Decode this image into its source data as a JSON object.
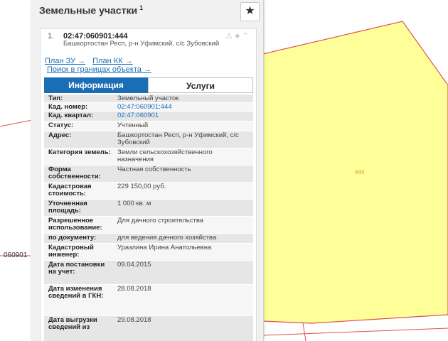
{
  "map": {
    "parcel_label": "444",
    "side_label": "060901",
    "parcel_fill": "#ffff99",
    "boundary_color": "#e05050"
  },
  "panel": {
    "title": "Земельные участки",
    "title_sup": "1",
    "favorite_icon": "star-icon"
  },
  "item": {
    "number": "1.",
    "cadastral": "02:47:060901:444",
    "address": "Башкортостан Респ, р-н Уфимский, с/с Зубовский",
    "tools": "⚠★⌃"
  },
  "links": {
    "plan_zu": "План ЗУ →",
    "plan_kk": "План КК →",
    "search": "Поиск в границах объекта →"
  },
  "tabs": {
    "info": "Информация",
    "services": "Услуги"
  },
  "rows": [
    {
      "label": "Тип:",
      "value": "Земельный участок"
    },
    {
      "label": "Кад. номер:",
      "value": "02:47:060901:444"
    },
    {
      "label": "Кад. квартал:",
      "value": "02:47:060901"
    },
    {
      "label": "Статус:",
      "value": "Учтенный"
    },
    {
      "label": "Адрес:",
      "value": "Башкортостан Респ, р-н Уфимский, с/с Зубовский"
    },
    {
      "label": "Категория земель:",
      "value": "Земли сельскохозяйственного назначения"
    },
    {
      "label": "Форма собственности:",
      "value": "Частная собственность"
    },
    {
      "label": "Кадастровая стоимость:",
      "value": "229 150,00 руб."
    },
    {
      "label": "Уточненная площадь:",
      "value": "1 000 кв. м"
    },
    {
      "label": "Разрешенное использование:",
      "value": "Для дачного строительства"
    },
    {
      "label": "по документу:",
      "value": "для ведения дачного хозяйства"
    },
    {
      "label": "Кадастровый инженер:",
      "value": "Уразлина Ирина Анатольевна"
    },
    {
      "label": "Дата постановки на учет:",
      "value": "09.04.2015"
    },
    {
      "label": "Дата изменения сведений в ГКН:",
      "value": "28.08.2018"
    },
    {
      "label": "Дата выгрузки сведений из",
      "value": "29.08.2018"
    }
  ]
}
